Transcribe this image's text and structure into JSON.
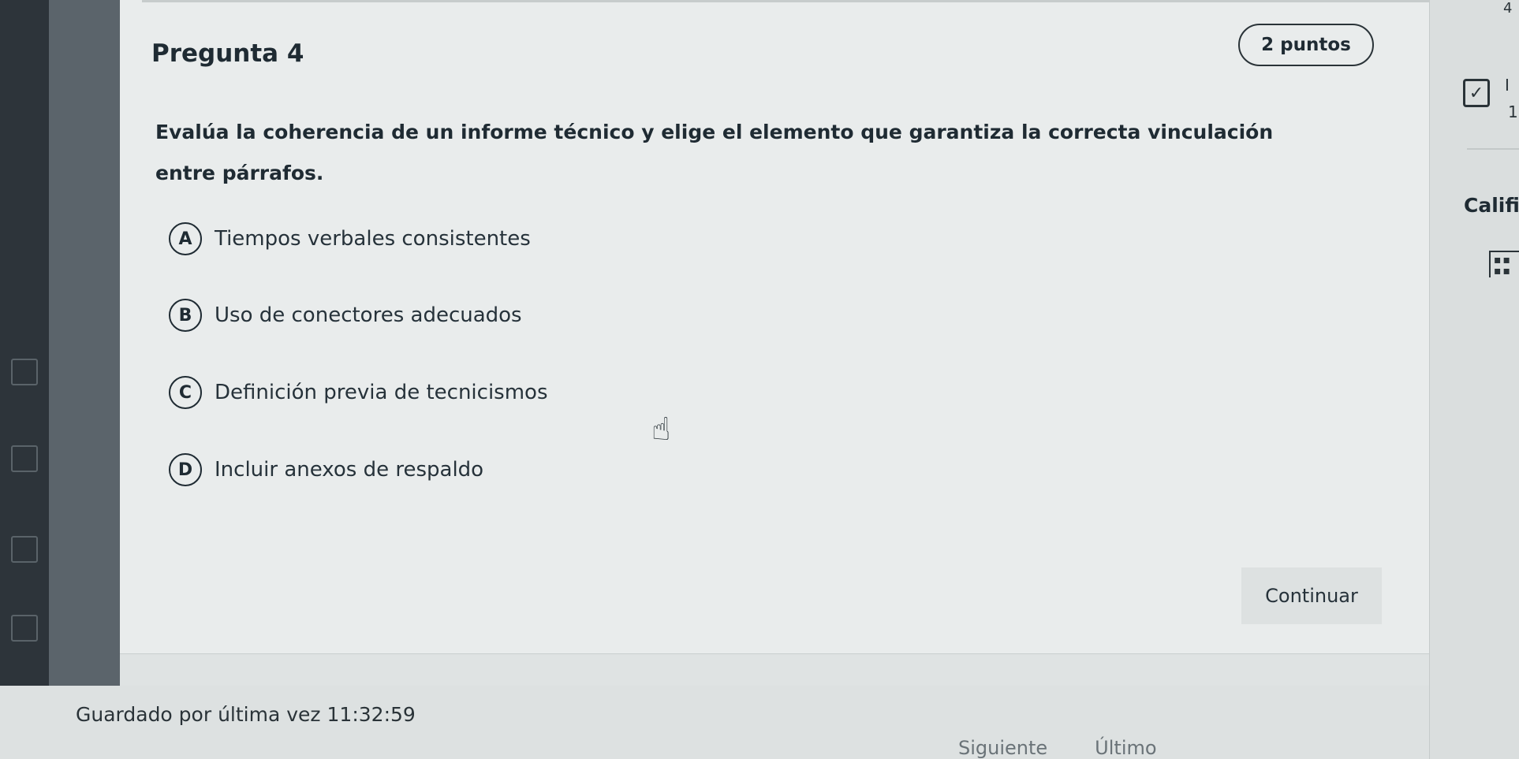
{
  "question": {
    "title": "Pregunta 4",
    "points": "2 puntos",
    "prompt": "Evalúa la coherencia de un informe técnico y elige el elemento que garantiza la correcta vinculación entre párrafos."
  },
  "options": [
    {
      "letter": "A",
      "text": "Tiempos verbales consistentes"
    },
    {
      "letter": "B",
      "text": "Uso de conectores adecuados"
    },
    {
      "letter": "C",
      "text": "Definición previa de tecnicismos"
    },
    {
      "letter": "D",
      "text": "Incluir anexos de respaldo"
    }
  ],
  "continue_label": "Continuar",
  "footer": {
    "saved_label": "Guardado por última vez",
    "saved_time": "11:32:59",
    "next_label": "Siguiente",
    "last_label": "Último"
  },
  "right_panel": {
    "top_number": "4",
    "num_1": "I",
    "num_2": "1",
    "grade_label": "Califi"
  },
  "icons": {
    "check": "checkbox-checked-icon",
    "grid": "grid-icon",
    "cursor": "hand-pointer-cursor"
  }
}
